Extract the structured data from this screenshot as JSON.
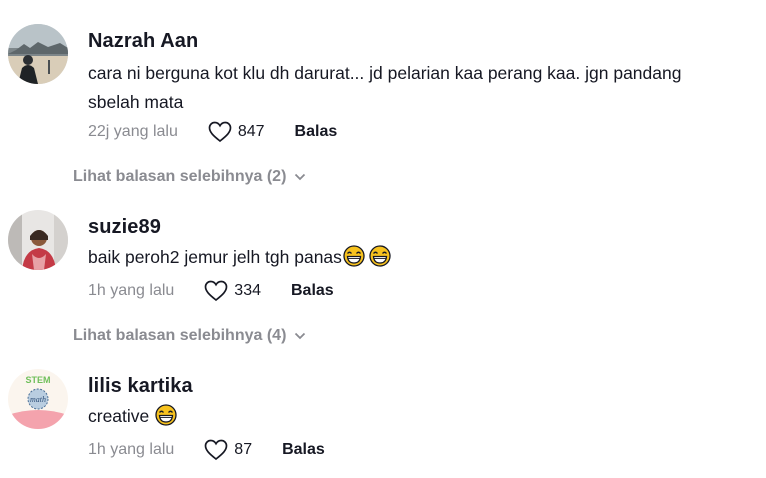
{
  "comments": [
    {
      "username": "Nazrah Aan",
      "text_line1": "cara ni berguna kot klu dh darurat... jd pelarian kaa perang kaa. jgn pandang",
      "text_line2": "sbelah mata",
      "time": "22j yang lalu",
      "likes": "847",
      "reply_label": "Balas",
      "more_replies": "Lihat balasan selebihnya (2)",
      "avatar_icon": "beach-photo-avatar"
    },
    {
      "username": "suzie89",
      "text": "baik peroh2 jemur jelh tgh panas",
      "emoji_count": 2,
      "time": "1h yang lalu",
      "likes": "334",
      "reply_label": "Balas",
      "more_replies": "Lihat balasan selebihnya (4)",
      "avatar_icon": "person-photo-avatar"
    },
    {
      "username": "lilis kartika",
      "text": "creative",
      "emoji_count": 1,
      "time": "1h yang lalu",
      "likes": "87",
      "reply_label": "Balas",
      "avatar_icon": "stem-math-logo-avatar",
      "avatar_text_top": "STEM",
      "avatar_text_mid": "math"
    }
  ],
  "colors": {
    "text": "#161823",
    "muted": "#8a8b91",
    "emoji": "#f7c21e"
  }
}
